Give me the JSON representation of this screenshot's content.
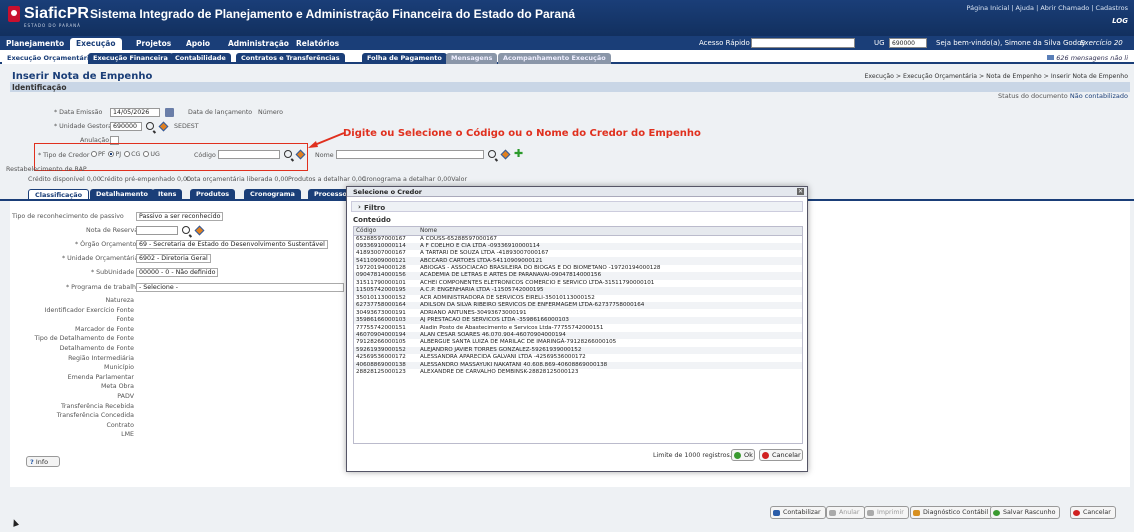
{
  "header": {
    "logo_name": "SiaficPR",
    "logo_sub": "ESTADO DO PARANÁ",
    "system_title": "Sistema Integrado de Planejamento e Administração Financeira do Estado do Paraná",
    "top_links": [
      "Página Inicial",
      "Ajuda",
      "Abrir Chamado",
      "Cadastros"
    ],
    "logout": "LOG"
  },
  "menu": {
    "items": [
      "Planejamento",
      "Execução",
      "Projetos",
      "Apoio",
      "Administração",
      "Relatórios"
    ],
    "active": "Execução",
    "quick_access_label": "Acesso Rápido",
    "ug_label": "UG",
    "ug_value": "690000",
    "welcome": "Seja bem-vindo(a), Simone da Silva Godoy",
    "exercicio": "Exercício 20"
  },
  "subtabs": {
    "items": [
      "Execução Orçamentária",
      "Execução Financeira",
      "Contabilidade",
      "Contratos e Transferências",
      "Folha de Pagamento",
      "Mensagens",
      "Acompanhamento Execução"
    ],
    "messages": "626 mensagens não li"
  },
  "page": {
    "title": "Inserir Nota de Empenho",
    "breadcrumb": "Execução > Execução Orçamentária > Nota de Empenho > Inserir Nota de Empenho",
    "section": "Identificação",
    "status_label": "Status do documento",
    "status_value": "Não contabilizado"
  },
  "ident": {
    "data_emissao_label": "* Data Emissão",
    "data_emissao_value": "14/05/2026",
    "data_lancamento_label": "Data de lançamento",
    "numero_label": "Número",
    "unidade_gestora_label": "* Unidade Gestora",
    "unidade_gestora_value": "690000",
    "unidade_gestora_name": "SEDEST",
    "anulacao_label": "Anulação",
    "tipo_credor_label": "* Tipo de Credor",
    "tipo_credor_options": [
      "PF",
      "PJ",
      "CG",
      "UG"
    ],
    "codigo_label": "Código",
    "nome_label": "Nome",
    "restabelecimento_label": "Restabelecimento de RAP",
    "credito_disponivel": "Crédito disponível 0,00",
    "credito_pre_empenhado": "Crédito pré-empenhado 0,00",
    "cota": "Cota orçamentária liberada 0,00",
    "produtos": "Produtos a detalhar 0,00",
    "cronograma": "Cronograma a detalhar 0,00Valor"
  },
  "annotation": "Digite ou Selecione o Código ou o Nome do Credor do Empenho",
  "content_tabs": [
    "Classificação",
    "Detalhamento",
    "Itens",
    "Produtos",
    "Cronograma",
    "Processo"
  ],
  "form": {
    "tipo_reconhecimento_label": "Tipo de reconhecimento de passivo",
    "tipo_reconhecimento_value": "Passivo a ser reconhecido",
    "nota_reserva_label": "Nota de Reserva",
    "orgao_label": "* Órgão Orçamento",
    "orgao_value": "69 - Secretaria de Estado do Desenvolvimento Sustentável",
    "unidade_orc_label": "* Unidade Orçamentária",
    "unidade_orc_value": "6902 - Diretoria Geral",
    "subunidade_label": "* SubUnidade",
    "subunidade_value": "00000 - 0 - Não definido",
    "programa_label": "* Programa de trabalho",
    "programa_value": "- Selecione -",
    "static_labels": [
      "Natureza",
      "Identificador Exercício Fonte",
      "Fonte",
      "Marcador de Fonte",
      "Tipo de Detalhamento de Fonte",
      "Detalhamento de Fonte",
      "Região Intermediária",
      "Município",
      "Emenda Parlamentar",
      "Meta Obra",
      "PADV",
      "Transferência Recebida",
      "Transferência Concedida",
      "Contrato",
      "LME"
    ],
    "info_button": "Info"
  },
  "actions": [
    "Contabilizar",
    "Anular",
    "Imprimir",
    "Diagnóstico Contábil",
    "Salvar Rascunho",
    "Cancelar"
  ],
  "modal": {
    "title": "Selecione o Credor",
    "filter_label": "Filtro",
    "content_label": "Conteúdo",
    "columns": [
      "Código",
      "Nome"
    ],
    "rows": [
      [
        "65288597000167",
        "A COUSS-65288597000167"
      ],
      [
        "09336910000114",
        "A F COELHO E CIA LTDA -09336910000114"
      ],
      [
        "41893007000167",
        "A TARTARI DE SOUZA LTDA -41893007000167"
      ],
      [
        "54110909000121",
        "ABCCARD CARTOES LTDA-54110909000121"
      ],
      [
        "19720194000128",
        "ABIOGAS - ASSOCIACAO BRASILEIRA DO BIOGAS E DO BIOMETANO -19720194000128"
      ],
      [
        "09047814000156",
        "ACADEMIA DE LETRAS E ARTES DE PARANAVAI-09047814000156"
      ],
      [
        "31511790000101",
        "ACHEI COMPONENTES ELETRONICOS COMERCIO E SERVICO LTDA-31511790000101"
      ],
      [
        "11505742000195",
        "A.C.P. ENGENHARIA LTDA -11505742000195"
      ],
      [
        "35010113000152",
        "ACR ADMINISTRADORA DE SERVICOS EIRELI-35010113000152"
      ],
      [
        "62737758000164",
        "ADILSON DA SILVA RIBEIRO SERVICOS DE ENFERMAGEM LTDA-62737758000164"
      ],
      [
        "30493673000191",
        "ADRIANO ANTUNES-30493673000191"
      ],
      [
        "35986166000103",
        "AJ PRESTACAO DE SERVICOS LTDA -35986166000103"
      ],
      [
        "77755742000151",
        "Aladin Posto de Abastecimento e Servicos Ltda-77755742000151"
      ],
      [
        "46070904000194",
        "ALAN CESAR SOARES 46.070.904-46070904000194"
      ],
      [
        "79128266000105",
        "ALBERGUE SANTA LUIZA DE MARILAC DE IMARINGÁ-79128266000105"
      ],
      [
        "59261939000152",
        "ALEJANDRO JAVIER TORRES GONZALEZ-59261939000152"
      ],
      [
        "42569536000172",
        "ALESSANDRA APARECIDA GALVANI LTDA -42569536000172"
      ],
      [
        "40608869000138",
        "ALESSANDRO MASSAYUKI NAKATANI 40.608.869-40608869000138"
      ],
      [
        "28828125000123",
        "ALEXANDRE DE CARVALHO DEMBINSK-28828125000123"
      ]
    ],
    "limit_text": "Limite de 1000 registros.",
    "ok": "Ok",
    "cancel": "Cancelar"
  }
}
